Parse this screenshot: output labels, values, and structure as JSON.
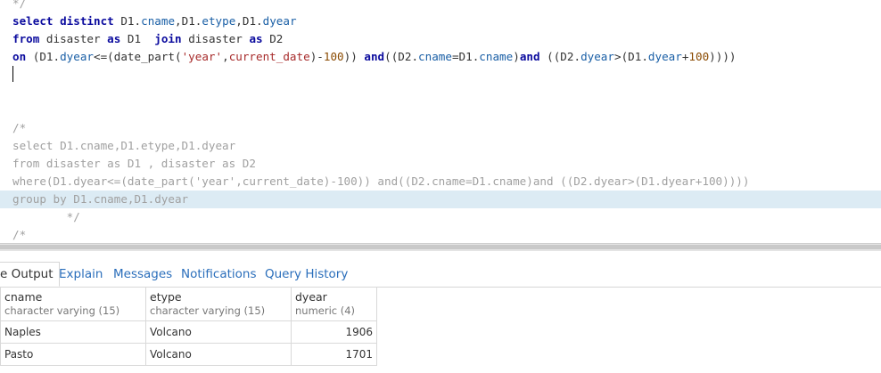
{
  "editor": {
    "lines": [
      {
        "top": 0,
        "text": "*/"
      },
      {
        "top": 0,
        "text": "select distinct D1.cname,D1.etype,D1.dyear"
      },
      {
        "top": 0,
        "text": "from disaster as D1  join disaster as D2"
      },
      {
        "top": 0,
        "text": "on (D1.dyear<=(date_part('year',current_date)-100)) and((D2.cname=D1.cname)and ((D2.dyear>(D1.dyear+100))))"
      },
      {
        "top": 0,
        "text": ""
      },
      {
        "top": 0,
        "text": ""
      },
      {
        "top": 0,
        "text": ""
      },
      {
        "top": 0,
        "text": "/*"
      },
      {
        "top": 0,
        "text": "select D1.cname,D1.etype,D1.dyear"
      },
      {
        "top": 0,
        "text": "from disaster as D1 , disaster as D2"
      },
      {
        "top": 0,
        "text": "where(D1.dyear<=(date_part('year',current_date)-100)) and((D2.cname=D1.cname)and ((D2.dyear>(D1.dyear+100))))"
      },
      {
        "top": 0,
        "text": "group by D1.cname,D1.dyear"
      },
      {
        "top": 0,
        "text": "        */"
      },
      {
        "top": 0,
        "text": ""
      },
      {
        "top": 0,
        "text": "/*"
      }
    ]
  },
  "tabs": [
    {
      "label": "e Output",
      "active": true
    },
    {
      "label": "Explain"
    },
    {
      "label": "Messages"
    },
    {
      "label": "Notifications"
    },
    {
      "label": "Query History"
    }
  ],
  "grid": {
    "columns": [
      {
        "name": "cname",
        "type": "character varying (15)"
      },
      {
        "name": "etype",
        "type": "character varying (15)"
      },
      {
        "name": "dyear",
        "type": "numeric (4)"
      }
    ],
    "rows": [
      [
        "Naples",
        "Volcano",
        "1906"
      ],
      [
        "Pasto",
        "Volcano",
        "1701"
      ]
    ]
  }
}
